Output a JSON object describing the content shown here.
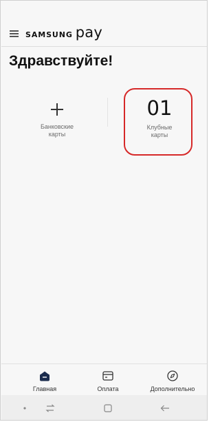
{
  "header": {
    "brand_samsung": "SAMSUNG",
    "brand_pay": "pay",
    "menu_icon": "hamburger-menu-icon"
  },
  "greeting": "Здравствуйте!",
  "tiles": {
    "bank": {
      "icon": "plus-icon",
      "label_line1": "Банковские",
      "label_line2": "карты"
    },
    "club": {
      "count": "01",
      "label_line1": "Клубные",
      "label_line2": "карты",
      "highlight_color": "#d62828"
    }
  },
  "tabs": [
    {
      "label": "Главная",
      "icon": "wallet-icon",
      "active": true
    },
    {
      "label": "Оплата",
      "icon": "card-icon",
      "active": false
    },
    {
      "label": "Дополнительно",
      "icon": "compass-icon",
      "active": false
    }
  ],
  "navbar": {
    "buttons": [
      "dot-icon",
      "recent-apps-icon",
      "home-icon",
      "back-icon"
    ]
  },
  "colors": {
    "background": "#f7f7f7",
    "active_tab_icon": "#1a2b4c",
    "highlight": "#d62828"
  }
}
